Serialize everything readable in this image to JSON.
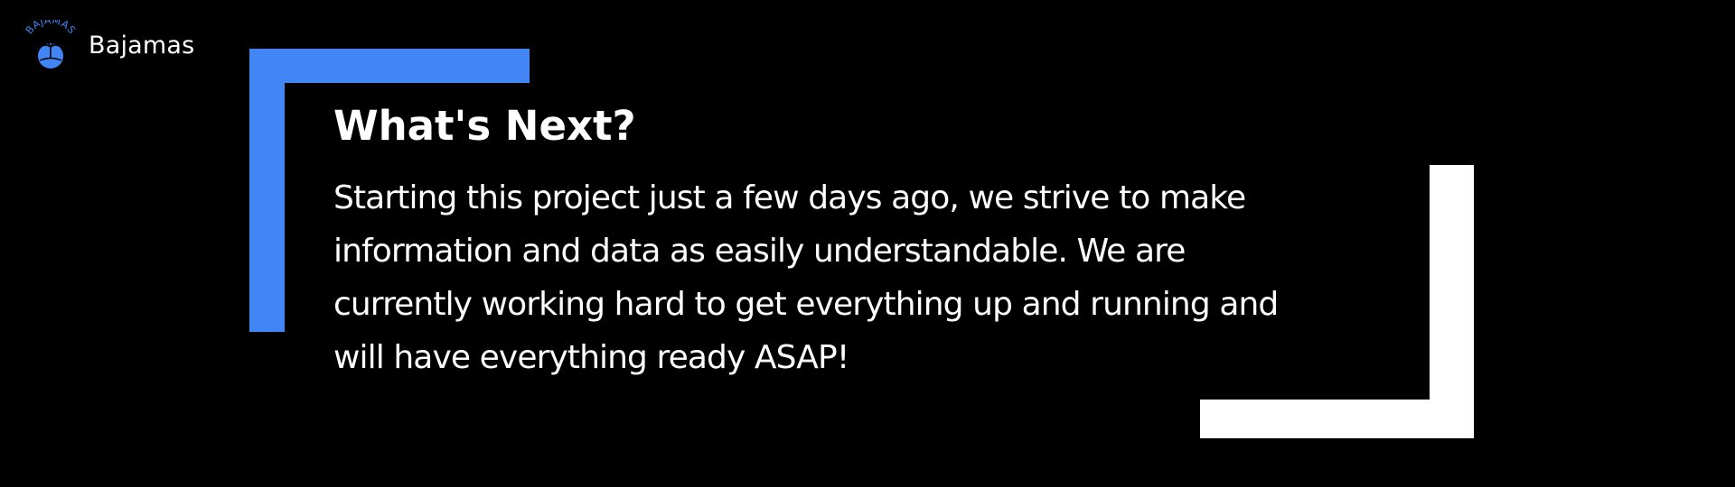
{
  "brand": {
    "name": "Bajamas",
    "logo_arc_text": "BAJAMAS",
    "logo_icon": "palm-tree-globe-icon",
    "accent_color": "#4285f4"
  },
  "section": {
    "heading": "What's Next?",
    "body_lines": [
      "Starting this project just a few days ago, we strive to make",
      "information and data as easily understandable. We are",
      "currently working hard to get everything up and running and",
      "will have everything ready ASAP!"
    ]
  },
  "colors": {
    "background": "#000000",
    "text": "#ffffff",
    "bracket_primary": "#4285f4",
    "bracket_secondary": "#ffffff"
  }
}
